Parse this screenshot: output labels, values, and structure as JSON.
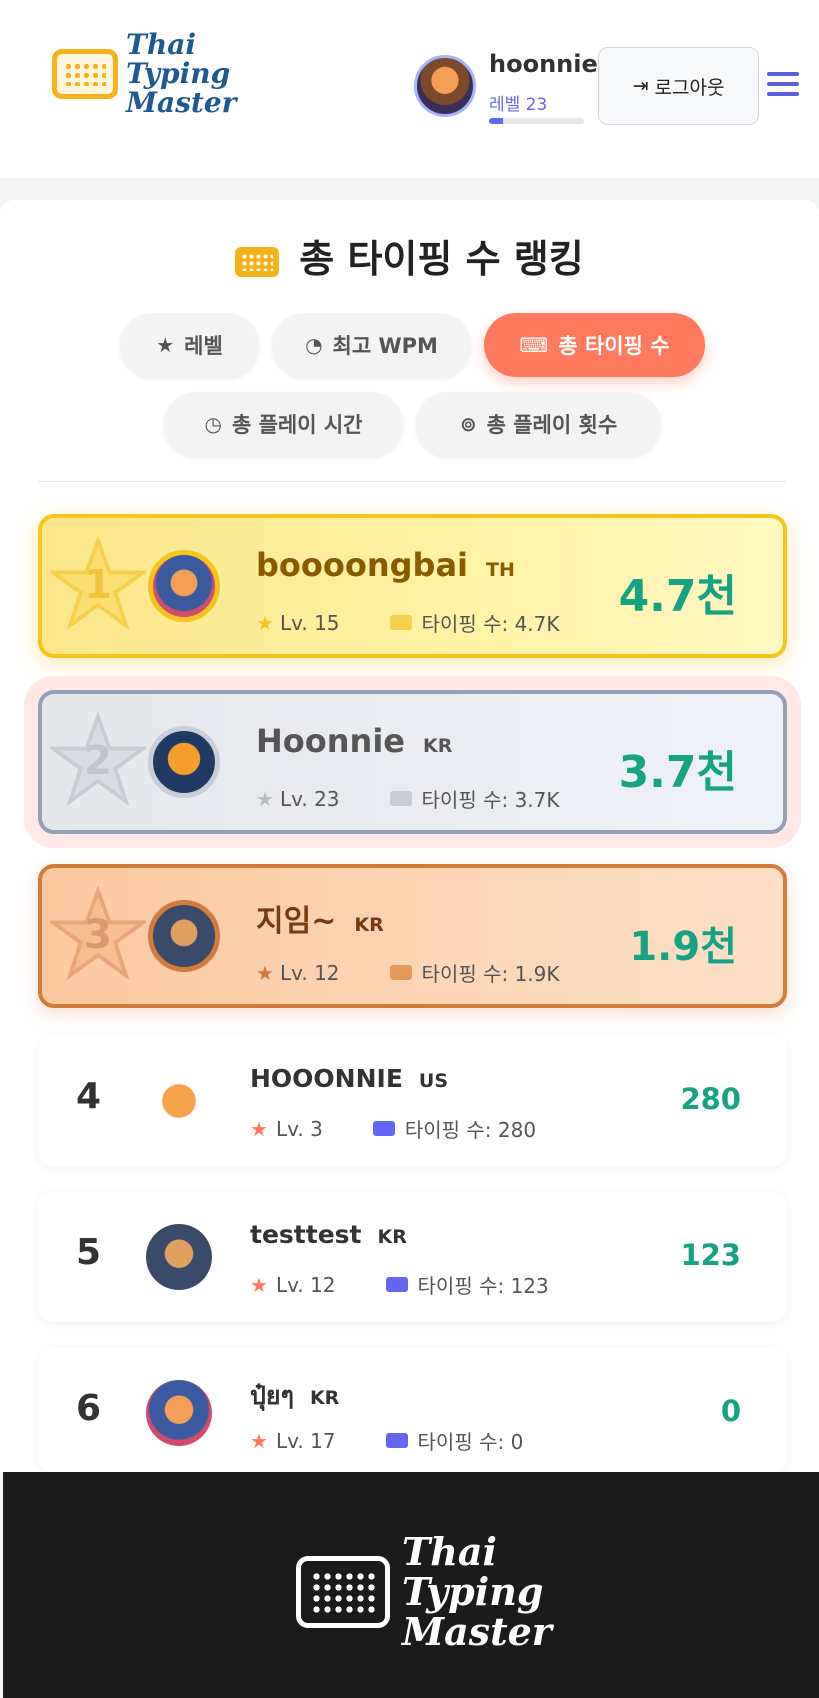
{
  "header": {
    "logo_lines": [
      "Thai",
      "Typing",
      "Master"
    ],
    "user": {
      "name": "hoonnie",
      "level_label": "레벨 23",
      "xp_progress": 0.15
    },
    "logout_label": "로그아웃"
  },
  "ranking": {
    "title": "총 타이핑 수 랭킹",
    "tabs": [
      {
        "label": "레벨",
        "icon": "star-icon"
      },
      {
        "label": "최고 WPM",
        "icon": "gauge-icon"
      },
      {
        "label": "총 타이핑 수",
        "icon": "keyboard-icon",
        "active": true
      },
      {
        "label": "총 플레이 시간",
        "icon": "clock-icon"
      },
      {
        "label": "총 플레이 횟수",
        "icon": "gamepad-icon"
      }
    ],
    "podium": [
      {
        "rank": "1",
        "name": "boooongbai",
        "country": "TH",
        "level": "Lv. 15",
        "typing": "타이핑 수: 4.7K",
        "score": "4.7천"
      },
      {
        "rank": "2",
        "name": "Hoonnie",
        "country": "KR",
        "level": "Lv. 23",
        "typing": "타이핑 수: 3.7K",
        "score": "3.7천"
      },
      {
        "rank": "3",
        "name": "지임~",
        "country": "KR",
        "level": "Lv. 12",
        "typing": "타이핑 수: 1.9K",
        "score": "1.9천"
      }
    ],
    "rows": [
      {
        "rank": "4",
        "name": "HOOONNIE",
        "country": "US",
        "level": "Lv. 3",
        "typing": "타이핑 수: 280",
        "score": "280"
      },
      {
        "rank": "5",
        "name": "testtest",
        "country": "KR",
        "level": "Lv. 12",
        "typing": "타이핑 수: 123",
        "score": "123"
      },
      {
        "rank": "6",
        "name": "ปุ๋ยๆ",
        "country": "KR",
        "level": "Lv. 17",
        "typing": "타이핑 수: 0",
        "score": "0"
      }
    ]
  },
  "footer": {
    "logo_lines": [
      "Thai",
      "Typing",
      "Master"
    ]
  },
  "colors": {
    "accent": "#ff7a5c",
    "score": "#16a383",
    "gold": "#f6c51d",
    "silver": "#93a0b8",
    "bronze": "#d47b3a",
    "brand": "#1e5a8f"
  }
}
